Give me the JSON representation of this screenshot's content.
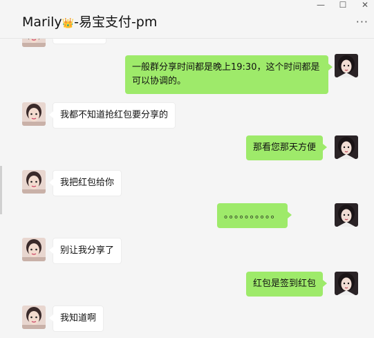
{
  "window": {
    "title": "Marily",
    "title_suffix": "-易宝支付-pm",
    "crown_icon": "👑",
    "minimize": "—",
    "maximize": "☐",
    "more": "···"
  },
  "colors": {
    "sent_bubble": "#9eea6a",
    "received_bubble": "#ffffff",
    "background": "#f5f5f5"
  },
  "messages": [
    {
      "side": "right",
      "text": "一般群分享时间都是晚上19:30，这个时间都是可以协调的。"
    },
    {
      "side": "left",
      "text": "我都不知道抢红包要分享的"
    },
    {
      "side": "right",
      "text": "那看您那天方便"
    },
    {
      "side": "left",
      "text": "我把红包给你"
    },
    {
      "side": "right",
      "text": "。。。。。。。。。。"
    },
    {
      "side": "left",
      "text": "别让我分享了"
    },
    {
      "side": "right",
      "text": "红包是签到红包"
    },
    {
      "side": "left",
      "text": "我知道啊"
    }
  ]
}
